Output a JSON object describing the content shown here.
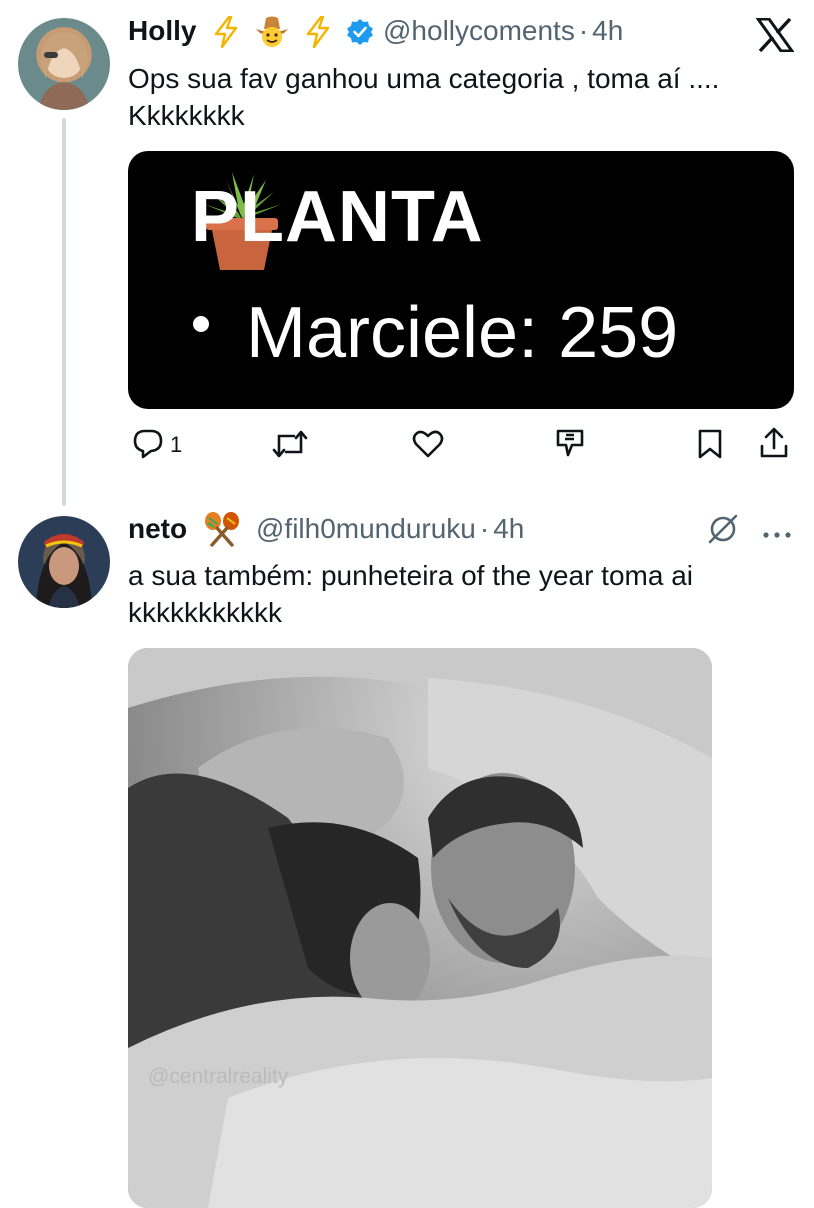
{
  "tweet1": {
    "display_name": "Holly",
    "name_emojis": [
      "⚡",
      "🤠",
      "⚡"
    ],
    "handle": "@hollycoments",
    "separator": "·",
    "time": "4h",
    "verified": true,
    "text_line1": "Ops sua fav ganhou uma categoria , toma aí ....",
    "text_line2": "Kkkkkkkk",
    "card": {
      "icon": "potted-plant",
      "title": "PLANTA",
      "item": "Marciele: 259"
    },
    "actions": {
      "reply_count": "1",
      "icons": [
        "reply-icon",
        "retweet-icon",
        "like-icon",
        "grok-icon",
        "bookmark-icon",
        "share-icon"
      ]
    }
  },
  "tweet2": {
    "display_name": "neto",
    "name_emoji": "🪇",
    "handle": "@filh0munduruku",
    "separator": "·",
    "time": "4h",
    "text_line1": "a sua também: punheteira of the year toma ai",
    "text_line2": "kkkkkkkkkkk",
    "media_watermark": "@centralreality"
  },
  "app_icon": "x-logo",
  "colors": {
    "text": "#0f1419",
    "secondary": "#536471",
    "verified": "#1d9bf0",
    "bolt": "#f4b400",
    "line": "#cfd9de"
  }
}
